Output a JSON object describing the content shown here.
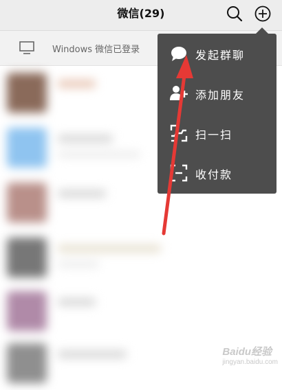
{
  "header": {
    "title": "微信(29)",
    "search_icon": "search-icon",
    "add_icon": "plus-circle-icon"
  },
  "login_bar": {
    "text": "Windows 微信已登录",
    "icon": "desktop-monitor-icon"
  },
  "popup_menu": {
    "items": [
      {
        "label": "发起群聊",
        "icon": "chat-bubble-icon"
      },
      {
        "label": "添加朋友",
        "icon": "add-friend-icon"
      },
      {
        "label": "扫一扫",
        "icon": "scan-icon"
      },
      {
        "label": "收付款",
        "icon": "payment-scan-icon"
      }
    ]
  },
  "chat_list": {
    "avatar_colors": [
      "#8a6a5a",
      "#8fc4f0",
      "#b9908a",
      "#777777",
      "#b08aa8",
      "#8f8f8f"
    ]
  },
  "annotation": {
    "arrow_color": "#e53935"
  },
  "watermark": {
    "site": "Baidu经验",
    "sub": "jingyan.baidu.com"
  },
  "colors": {
    "menu_background": "#4d4d4d",
    "header_background": "#ededed"
  }
}
